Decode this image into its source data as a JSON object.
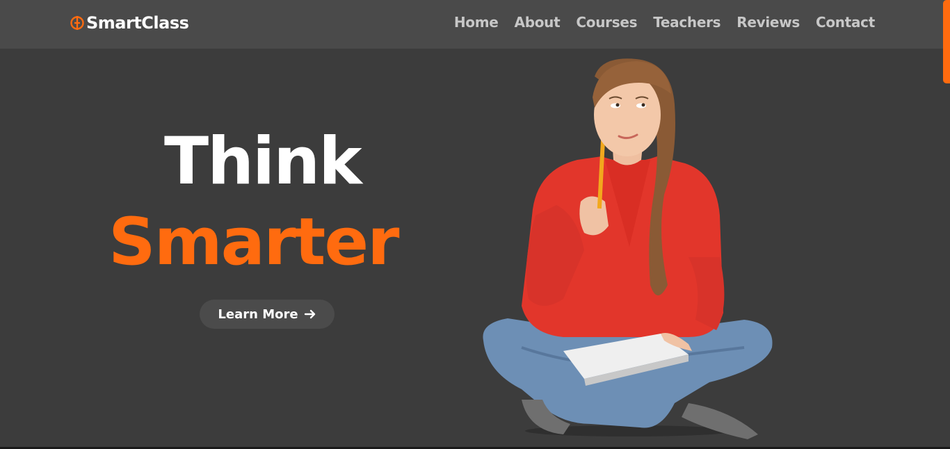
{
  "brand": {
    "name": "SmartClass",
    "accent": "#ff6b0f"
  },
  "nav": {
    "items": [
      {
        "label": "Home"
      },
      {
        "label": "About"
      },
      {
        "label": "Courses"
      },
      {
        "label": "Teachers"
      },
      {
        "label": "Reviews"
      },
      {
        "label": "Contact"
      }
    ]
  },
  "hero": {
    "title_line1": "Think",
    "title_line2": "Smarter",
    "cta_label": "Learn More",
    "cta_icon": "arrow-right-icon"
  }
}
